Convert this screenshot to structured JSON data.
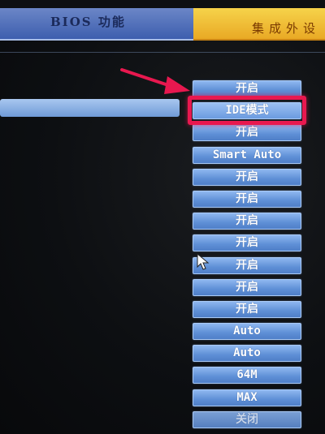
{
  "header": {
    "left_tab_label": "BIOS 功能",
    "right_tab_label": "集成外设"
  },
  "options": [
    {
      "label": "开启",
      "state": "normal"
    },
    {
      "label": "IDE模式",
      "state": "selected"
    },
    {
      "label": "开启",
      "state": "normal"
    },
    {
      "label": "Smart Auto",
      "state": "normal"
    },
    {
      "label": "开启",
      "state": "normal"
    },
    {
      "label": "开启",
      "state": "normal"
    },
    {
      "label": "开启",
      "state": "normal"
    },
    {
      "label": "开启",
      "state": "normal"
    },
    {
      "label": "开启",
      "state": "normal"
    },
    {
      "label": "开启",
      "state": "normal"
    },
    {
      "label": "开启",
      "state": "normal"
    },
    {
      "label": "Auto",
      "state": "normal"
    },
    {
      "label": "Auto",
      "state": "normal"
    },
    {
      "label": "64M",
      "state": "normal"
    },
    {
      "label": "MAX",
      "state": "normal"
    },
    {
      "label": "关闭",
      "state": "dim"
    }
  ],
  "colors": {
    "focus_frame": "#e8184f",
    "option_fill": "#5e8fd6",
    "header_right": "#f6d34a",
    "header_left": "#3d5eae"
  },
  "icons": {
    "annotation": "pointer-arrow-icon",
    "cursor": "mouse-cursor-icon"
  }
}
